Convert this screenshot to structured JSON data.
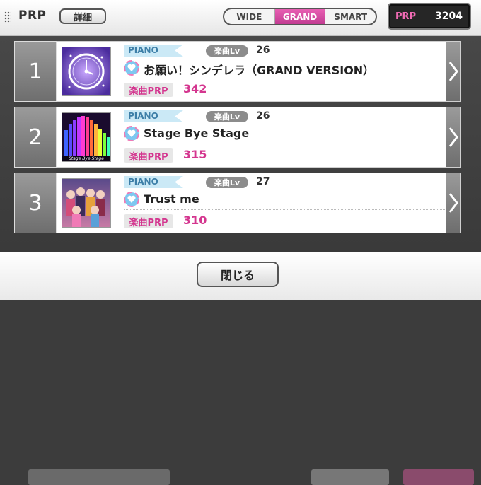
{
  "header": {
    "title": "PRP",
    "detail_button": "詳細",
    "view_modes": [
      "WIDE",
      "GRAND",
      "SMART"
    ],
    "active_mode": "GRAND",
    "prp_label": "PRP",
    "prp_value": "3204"
  },
  "tag_labels": {
    "part": "PIANO",
    "level": "楽曲Lv",
    "prp": "楽曲PRP"
  },
  "rows": [
    {
      "rank": "1",
      "level": "26",
      "title": "お願い！シンデレラ（GRAND VERSION）",
      "prp": "342",
      "jacket_icon": "clock-jacket"
    },
    {
      "rank": "2",
      "level": "26",
      "title": "Stage Bye Stage",
      "prp": "315",
      "jacket_icon": "equalizer-jacket",
      "jacket_caption": "Stage Bye Stage"
    },
    {
      "rank": "3",
      "level": "27",
      "title": "Trust me",
      "prp": "310",
      "jacket_icon": "group-photo-jacket"
    }
  ],
  "footer": {
    "close_button": "閉じる"
  },
  "colors": {
    "accent": "#d4368f",
    "active_tab": "#e85fb3",
    "piano_tag": "#cbe9f6"
  }
}
